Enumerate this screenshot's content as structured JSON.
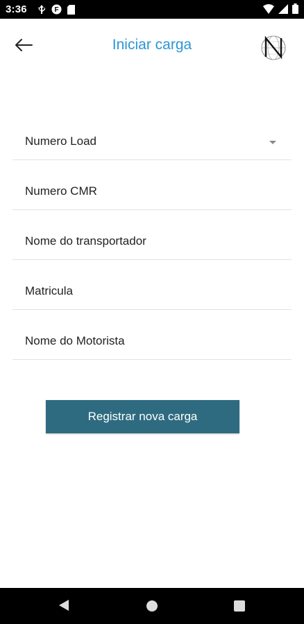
{
  "status_bar": {
    "time": "3:36",
    "left_icons": [
      "usb-debug-icon",
      "notification-icon",
      "sd-card-icon"
    ],
    "right_icons": [
      "wifi-icon",
      "signal-icon",
      "battery-icon"
    ]
  },
  "app_bar": {
    "title": "Iniciar carga",
    "back_icon": "arrow-left-icon",
    "logo_icon": "n-globe-logo"
  },
  "form": {
    "fields": [
      {
        "label": "Numero Load",
        "type": "dropdown"
      },
      {
        "label": "Numero CMR",
        "type": "text"
      },
      {
        "label": "Nome do transportador",
        "type": "text"
      },
      {
        "label": "Matricula",
        "type": "text"
      },
      {
        "label": "Nome do Motorista",
        "type": "text"
      }
    ],
    "submit_label": "Registrar nova carga"
  },
  "nav_bar": {
    "buttons": [
      "back-triangle-icon",
      "home-circle-icon",
      "recents-square-icon"
    ]
  },
  "colors": {
    "title": "#2b96d4",
    "button": "#2e6b80",
    "divider": "#e2e2e2"
  }
}
